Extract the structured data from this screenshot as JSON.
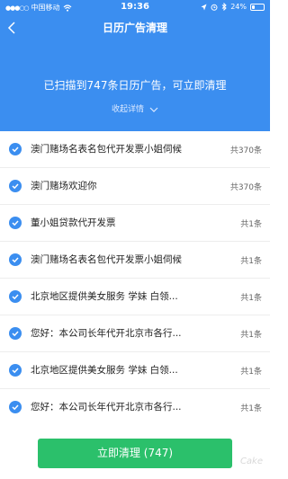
{
  "status_bar": {
    "carrier": "中国移动",
    "time": "19:36",
    "battery": "24%",
    "battery_level": 0.24,
    "icons": [
      "signal-dots-icon",
      "wifi-icon",
      "location-icon",
      "alarm-icon",
      "bluetooth-icon",
      "battery-icon"
    ]
  },
  "nav": {
    "title": "日历广告清理",
    "back_icon": "chevron-left-icon"
  },
  "summary": {
    "text": "已扫描到747条日历广告，可立即清理",
    "collapse_label": "收起详情",
    "collapse_icon": "chevron-down-icon"
  },
  "items": [
    {
      "text": "澳门赌场名表名包代开发票小姐伺候",
      "count": "共370条"
    },
    {
      "text": "澳门赌场欢迎你",
      "count": "共370条"
    },
    {
      "text": "董小姐贷款代开发票",
      "count": "共1条"
    },
    {
      "text": "澳门赌场名表名包代开发票小姐伺候",
      "count": "共1条"
    },
    {
      "text": "北京地区提供美女服务 学妹 白领...",
      "count": "共1条"
    },
    {
      "text": "您好：本公司长年代开北京市各行...",
      "count": "共1条"
    },
    {
      "text": "北京地区提供美女服务 学妹 白领...",
      "count": "共1条"
    },
    {
      "text": "您好：本公司长年代开北京市各行...",
      "count": "共1条"
    }
  ],
  "footer": {
    "button_label": "立即清理 (747)",
    "watermark": "Cake"
  },
  "colors": {
    "header": "#3b8ef0",
    "check": "#3b8ef0",
    "button": "#2bc06b"
  }
}
